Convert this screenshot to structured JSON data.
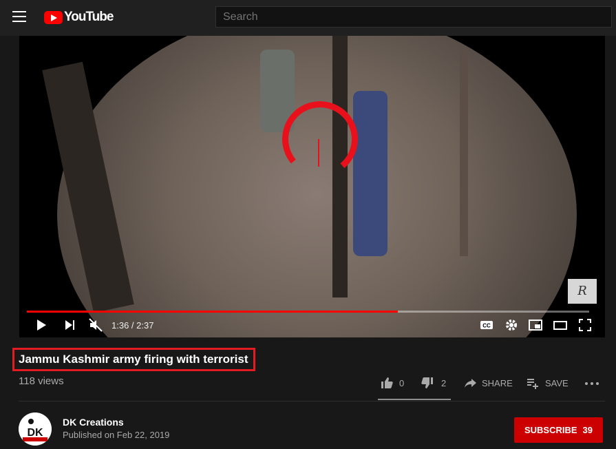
{
  "header": {
    "logo_text": "YouTube",
    "search_placeholder": "Search"
  },
  "player": {
    "progress": 0.66,
    "time_display": "1:36 / 2:37",
    "watermark": "R"
  },
  "video": {
    "title": "Jammu Kashmir army firing with terrorist",
    "views": "118 views",
    "likes": "0",
    "dislikes": "2",
    "share_label": "SHARE",
    "save_label": "SAVE"
  },
  "channel": {
    "name": "DK Creations",
    "published": "Published on Feb 22, 2019",
    "avatar_text": "DK",
    "subscribe_label": "SUBSCRIBE",
    "subscriber_count": "39"
  },
  "colors": {
    "accent": "#ff0000",
    "highlight_box": "#e31b23",
    "subscribe": "#cc0000"
  }
}
